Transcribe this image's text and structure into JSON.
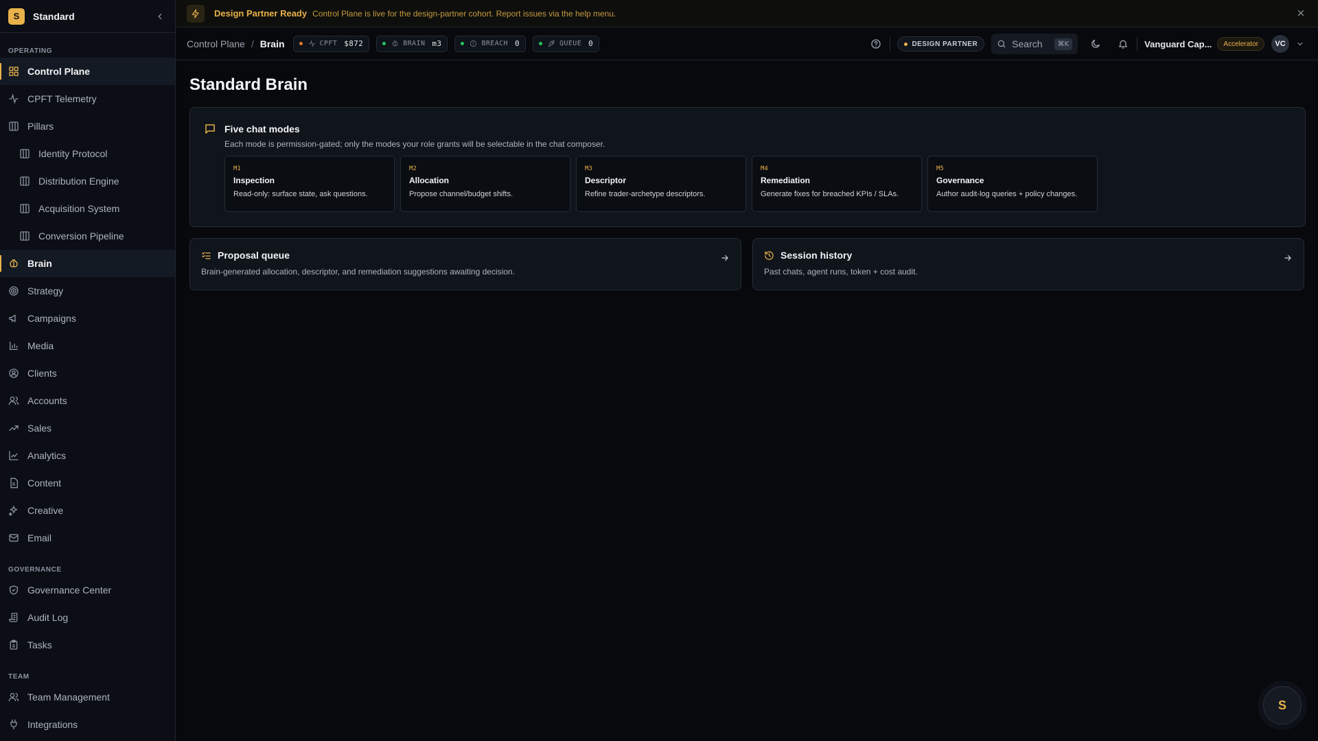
{
  "app": {
    "logo_letter": "S",
    "name": "Standard"
  },
  "sidebar": {
    "sections": [
      {
        "label": "OPERATING"
      },
      {
        "label": "GOVERNANCE"
      },
      {
        "label": "TEAM"
      }
    ],
    "items": [
      {
        "label": "Control Plane"
      },
      {
        "label": "CPFT Telemetry"
      },
      {
        "label": "Pillars"
      },
      {
        "label": "Identity Protocol"
      },
      {
        "label": "Distribution Engine"
      },
      {
        "label": "Acquisition System"
      },
      {
        "label": "Conversion Pipeline"
      },
      {
        "label": "Brain"
      },
      {
        "label": "Strategy"
      },
      {
        "label": "Campaigns"
      },
      {
        "label": "Media"
      },
      {
        "label": "Clients"
      },
      {
        "label": "Accounts"
      },
      {
        "label": "Sales"
      },
      {
        "label": "Analytics"
      },
      {
        "label": "Content"
      },
      {
        "label": "Creative"
      },
      {
        "label": "Email"
      },
      {
        "label": "Governance Center"
      },
      {
        "label": "Audit Log"
      },
      {
        "label": "Tasks"
      },
      {
        "label": "Team Management"
      },
      {
        "label": "Integrations"
      }
    ]
  },
  "banner": {
    "title": "Design Partner Ready",
    "text": "Control Plane is live for the design-partner cohort. Report issues via the help menu."
  },
  "topbar": {
    "breadcrumb": [
      "Control Plane",
      "/",
      "Brain"
    ],
    "pills": [
      {
        "label": "CPFT",
        "value": "$872",
        "dot_color": "#e07a2e"
      },
      {
        "label": "BRAIN",
        "value": "m3",
        "dot_color": "#22c55e"
      },
      {
        "label": "BREACH",
        "value": "0",
        "dot_color": "#22c55e"
      },
      {
        "label": "QUEUE",
        "value": "0",
        "dot_color": "#22c55e"
      }
    ],
    "badge": "DESIGN PARTNER",
    "search": {
      "placeholder": "Search",
      "shortcut": "⌘K"
    },
    "org": "Vanguard Cap...",
    "plan": "Accelerator",
    "avatar": "VC"
  },
  "main": {
    "title": "Standard Brain",
    "modes_card": {
      "title": "Five chat modes",
      "description": "Each mode is permission-gated; only the modes your role grants will be selectable in the chat composer.",
      "modes": [
        {
          "code": "M1",
          "name": "Inspection",
          "description": "Read-only: surface state, ask questions."
        },
        {
          "code": "M2",
          "name": "Allocation",
          "description": "Propose channel/budget shifts."
        },
        {
          "code": "M3",
          "name": "Descriptor",
          "description": "Refine trader-archetype descriptors."
        },
        {
          "code": "M4",
          "name": "Remediation",
          "description": "Generate fixes for breached KPIs / SLAs."
        },
        {
          "code": "M5",
          "name": "Governance",
          "description": "Author audit-log queries + policy changes."
        }
      ]
    },
    "proposal_queue": {
      "title": "Proposal queue",
      "description": "Brain-generated allocation, descriptor, and remediation suggestions awaiting decision."
    },
    "session_history": {
      "title": "Session history",
      "description": "Past chats, agent runs, token + cost audit."
    }
  },
  "fab": {
    "letter": "S"
  },
  "colors": {
    "accent": "#e9b24a",
    "background": "#07090d",
    "card": "#10141b"
  }
}
